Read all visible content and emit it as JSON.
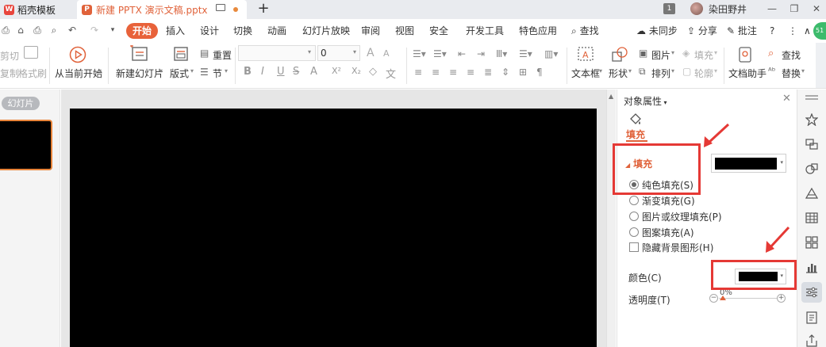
{
  "titlebar": {
    "template_tab": "稻壳模板",
    "doc_tab": "新建 PPTX 演示文稿.pptx",
    "window_count": "1",
    "username": "染田野井",
    "minimize": "—",
    "restore": "❐",
    "close": "✕"
  },
  "menu": {
    "items": [
      "开始",
      "插入",
      "设计",
      "切换",
      "动画",
      "幻灯片放映",
      "审阅",
      "视图",
      "安全",
      "开发工具",
      "特色应用"
    ],
    "search": "查找",
    "sync": "未同步",
    "share": "分享",
    "comment": "批注",
    "help": "?",
    "more": "⋮",
    "collapse": "∧",
    "badge": "51"
  },
  "ribbon": {
    "cut": "剪切",
    "copy": "复制",
    "format_painter": "格式刷",
    "start_from_current": "从当前开始",
    "new_slide": "新建幻灯片",
    "layout": "版式",
    "reset": "重置",
    "section": "节",
    "font_name": "",
    "font_size": "0",
    "textbox": "文本框",
    "shape": "形状",
    "picture": "图片",
    "fill": "填充",
    "arrange": "排列",
    "outline": "轮廓",
    "doc_assistant": "文档助手",
    "find": "查找",
    "replace": "替换"
  },
  "slides_panel": {
    "tab": "幻灯片"
  },
  "property_pane": {
    "title": "对象属性",
    "fill_tab": "填充",
    "section_title": "填充",
    "fill_options": [
      {
        "label": "纯色填充(S)",
        "selected": true
      },
      {
        "label": "渐变填充(G)",
        "selected": false
      },
      {
        "label": "图片或纹理填充(P)",
        "selected": false
      },
      {
        "label": "图案填充(A)",
        "selected": false
      }
    ],
    "hide_bg": "隐藏背景图形(H)",
    "color_label": "颜色(C)",
    "transparency_label": "透明度(T)",
    "transparency_value": "0%",
    "transparency": 0,
    "fill_color": "#000000"
  },
  "colors": {
    "accent": "#e8623a",
    "annotation": "#e53935",
    "slide_background": "#000000"
  }
}
